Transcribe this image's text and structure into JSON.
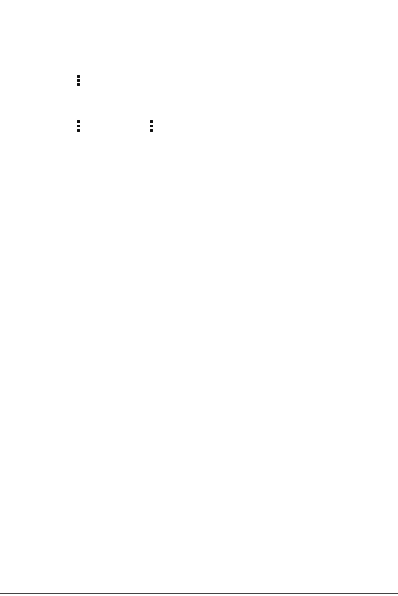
{
  "page": {
    "background_color": "#ffffff"
  },
  "icons": [
    {
      "name": "more-vert-icon"
    },
    {
      "name": "more-vert-icon"
    },
    {
      "name": "more-vert-icon"
    }
  ],
  "colors": {
    "icon": "#111111",
    "rule": "#444444"
  }
}
